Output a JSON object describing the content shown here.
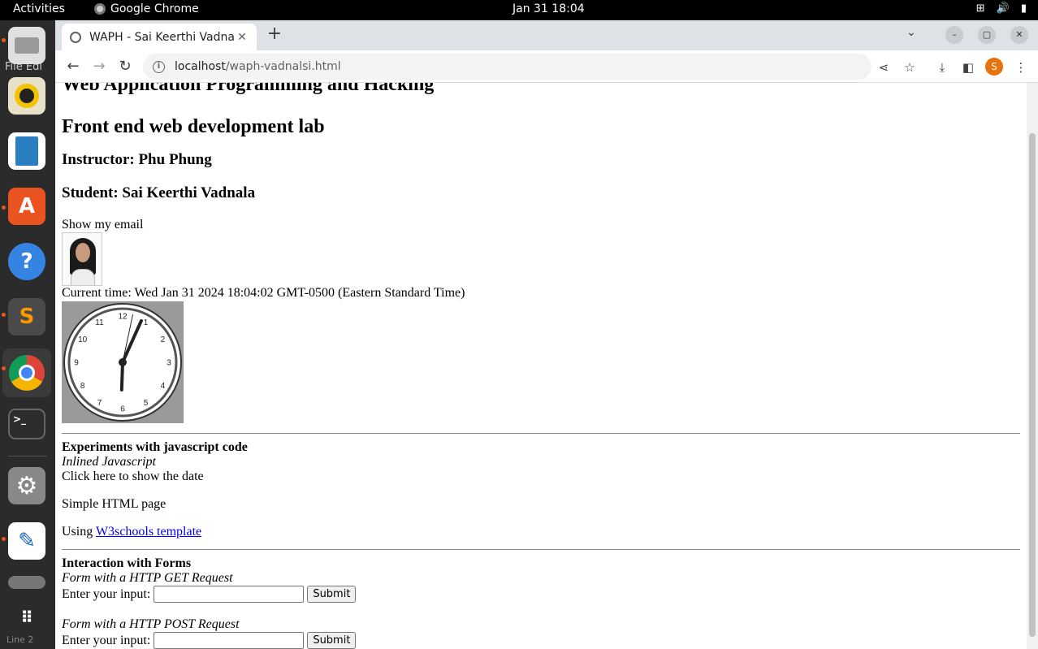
{
  "topbar": {
    "activities": "Activities",
    "app_name": "Google Chrome",
    "datetime": "Jan 31  18:04"
  },
  "dock": {
    "behind_text": "File  Edi",
    "status_text": "Line 2"
  },
  "browser": {
    "tab_title": "WAPH - Sai Keerthi Vadnalsi",
    "url_host": "localhost",
    "url_path": "/waph-vadnalsi.html",
    "profile_initial": "S"
  },
  "page": {
    "cut_heading": "Web Application Programming and Hacking",
    "h2": "Front end web development lab",
    "instructor": "Instructor: Phu Phung",
    "student": "Student: Sai Keerthi Vadnala",
    "show_email": "Show my email",
    "current_time": "Current time: Wed Jan 31 2024 18:04:02 GMT-0500 (Eastern Standard Time)",
    "clock": {
      "hour": 18,
      "minute": 4,
      "second": 2,
      "numbers": [
        "12",
        "1",
        "2",
        "3",
        "4",
        "5",
        "6",
        "7",
        "8",
        "9",
        "10",
        "11"
      ]
    },
    "js_section": {
      "title": "Experiments with javascript code",
      "subtitle": "Inlined Javascript",
      "click_text": "Click here to show the date",
      "simple_page": "Simple HTML page",
      "using_prefix": "Using ",
      "link_text": "W3schools template"
    },
    "forms_section": {
      "title": "Interaction with Forms",
      "get_title": "Form with a HTTP GET Request",
      "post_title": "Form with a HTTP POST Request",
      "input_label": "Enter your input:",
      "submit_label": "Submit"
    }
  }
}
